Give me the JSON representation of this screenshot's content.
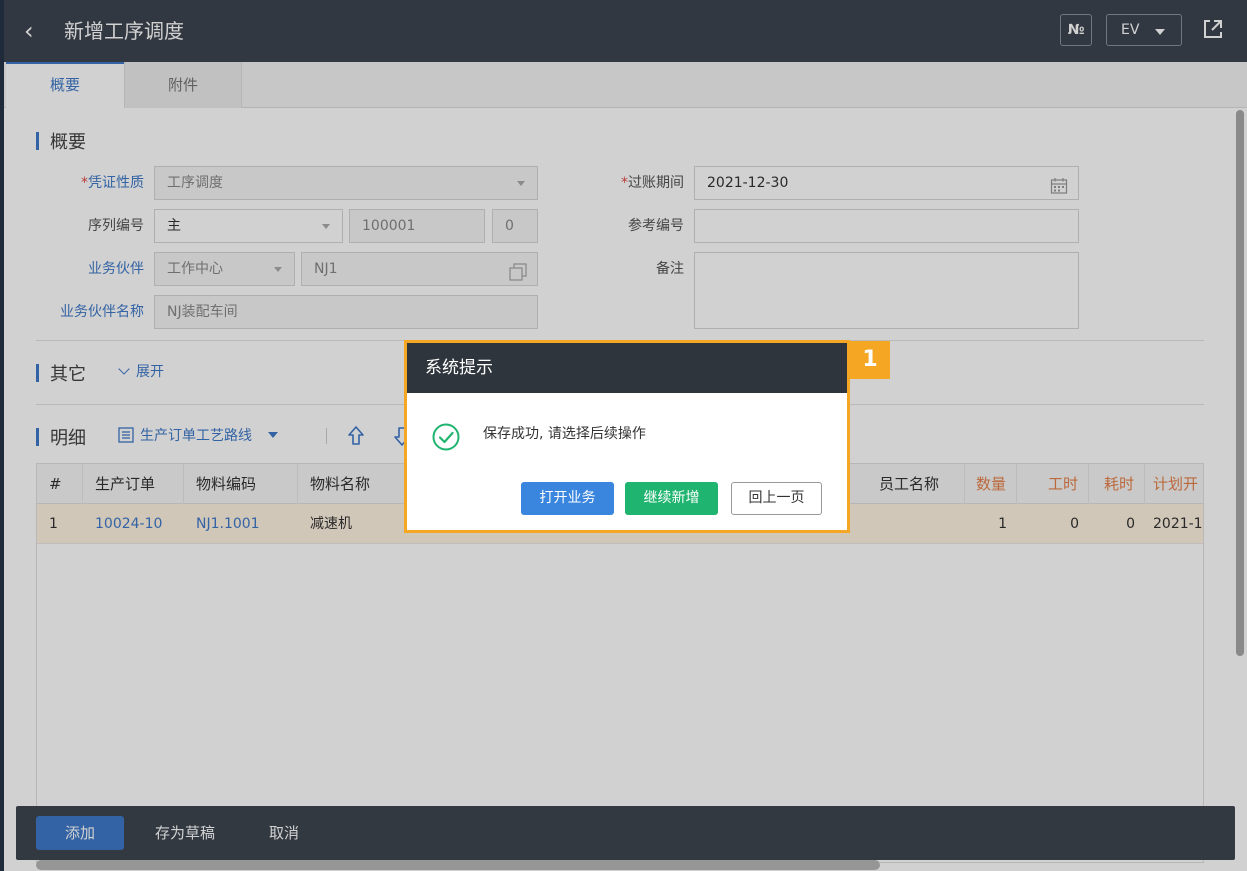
{
  "header": {
    "back_glyph": "‹",
    "title": "新增工序调度",
    "number_button": "№",
    "lang_button": "EV",
    "share_icon": "share-icon"
  },
  "tabs": [
    {
      "label": "概要",
      "active": true
    },
    {
      "label": "附件",
      "active": false
    }
  ],
  "summary": {
    "section_title": "概要",
    "voucher_type": {
      "label": "凭证性质",
      "required": "*",
      "value": "工序调度"
    },
    "serial": {
      "label": "序列编号",
      "value": "主",
      "number": "100001",
      "suffix": "0"
    },
    "partner": {
      "label": "业务伙伴",
      "type": "工作中心",
      "code": "NJ1"
    },
    "partner_name": {
      "label": "业务伙伴名称",
      "value": "NJ装配车间"
    },
    "posting_period": {
      "label": "过账期间",
      "required": "*",
      "value": "2021-12-30"
    },
    "reference_no": {
      "label": "参考编号",
      "value": ""
    },
    "remark": {
      "label": "备注",
      "value": ""
    }
  },
  "other": {
    "section_title": "其它",
    "expand_label": "展开"
  },
  "detail": {
    "section_title": "明细",
    "route_link": "生产订单工艺路线",
    "columns": [
      "#",
      "生产订单",
      "物料编码",
      "物料名称",
      "员工名称",
      "数量",
      "工时",
      "耗时",
      "计划开"
    ],
    "rows": [
      {
        "index": "1",
        "order": "10024-10",
        "item_code": "NJ1.1001",
        "item_name": "减速机",
        "qty": "1",
        "hours": "0",
        "elapsed": "0",
        "plan_start": "2021-1"
      }
    ]
  },
  "footer": {
    "add": "添加",
    "save_draft": "存为草稿",
    "cancel": "取消"
  },
  "dialog": {
    "title": "系统提示",
    "message": "保存成功, 请选择后续操作",
    "open_business": "打开业务",
    "continue_new": "继续新增",
    "back_page": "回上一页"
  },
  "callout_badge": "1",
  "colors": {
    "accent": "#3f79c9",
    "success": "#1fb46f",
    "highlight": "#f5a623"
  }
}
